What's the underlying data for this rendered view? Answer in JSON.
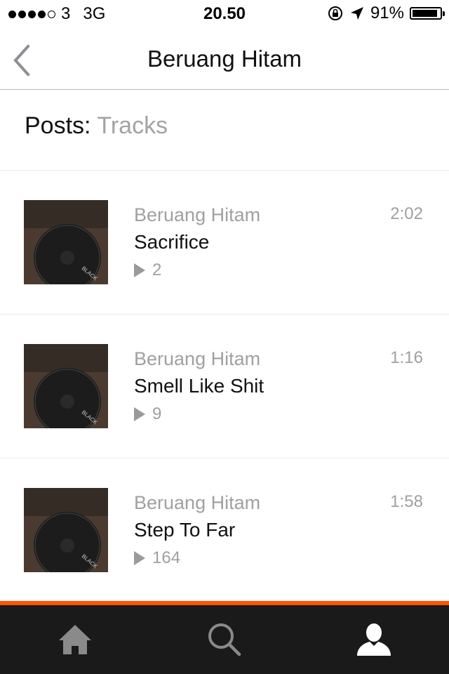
{
  "status_bar": {
    "carrier": "3",
    "network": "3G",
    "time": "20.50",
    "battery": "91%",
    "battery_level": 0.91
  },
  "nav": {
    "title": "Beruang Hitam",
    "back_icon": "chevron-left-icon"
  },
  "posts": {
    "label": "Posts:",
    "value": "Tracks"
  },
  "tracks": [
    {
      "artist": "Beruang Hitam",
      "title": "Sacrifice",
      "duration": "2:02",
      "plays": "2"
    },
    {
      "artist": "Beruang Hitam",
      "title": "Smell Like Shit",
      "duration": "1:16",
      "plays": "9"
    },
    {
      "artist": "Beruang Hitam",
      "title": "Step To Far",
      "duration": "1:58",
      "plays": "164"
    }
  ],
  "tab_bar": {
    "tabs": [
      {
        "icon": "home-icon",
        "active": false
      },
      {
        "icon": "search-icon",
        "active": false
      },
      {
        "icon": "user-icon",
        "active": true
      }
    ]
  },
  "colors": {
    "accent": "#ff5500",
    "tab_bar_bg": "#1a1a1a",
    "secondary_text": "#a0a0a0"
  }
}
